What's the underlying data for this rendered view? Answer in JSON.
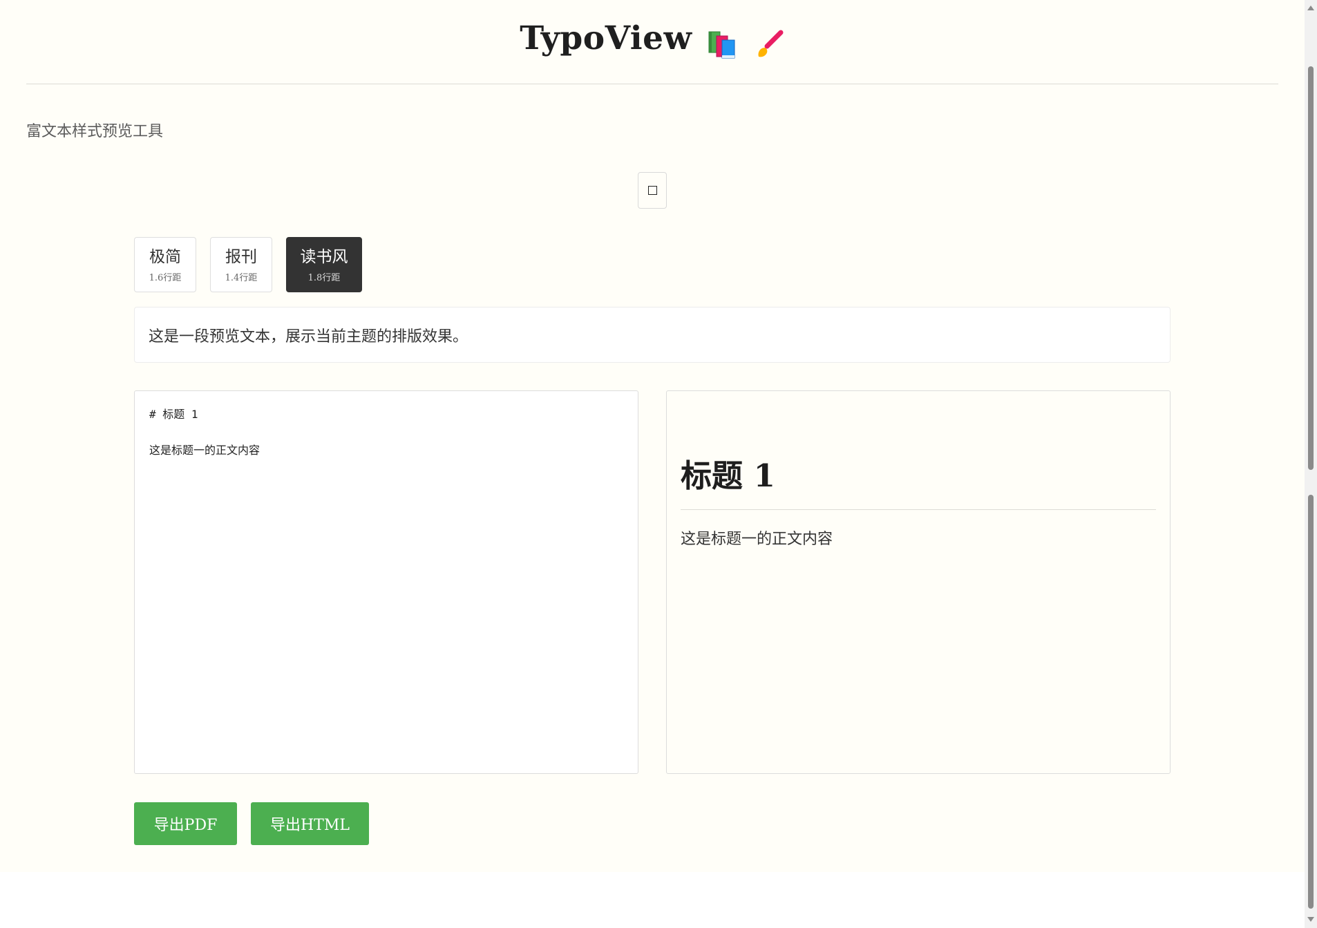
{
  "header": {
    "title": "TypoView",
    "icons": [
      "books-icon",
      "paintbrush-icon"
    ]
  },
  "subtitle": "富文本样式预览工具",
  "toggle": {
    "icon": "square-icon"
  },
  "themes": [
    {
      "name": "极简",
      "line_height": "1.6行距",
      "active": false
    },
    {
      "name": "报刊",
      "line_height": "1.4行距",
      "active": false
    },
    {
      "name": "读书风",
      "line_height": "1.8行距",
      "active": true
    }
  ],
  "preview_sample": "这是一段预览文本，展示当前主题的排版效果。",
  "editor": {
    "lines": [
      "# 标题 1",
      "",
      "这是标题一的正文内容"
    ]
  },
  "rendered": {
    "heading": "标题 1",
    "paragraph": "这是标题一的正文内容"
  },
  "export": {
    "pdf_label": "导出PDF",
    "html_label": "导出HTML"
  },
  "colors": {
    "page_bg": "#fffef8",
    "active_theme": "#333333",
    "export_button": "#4caf50"
  }
}
